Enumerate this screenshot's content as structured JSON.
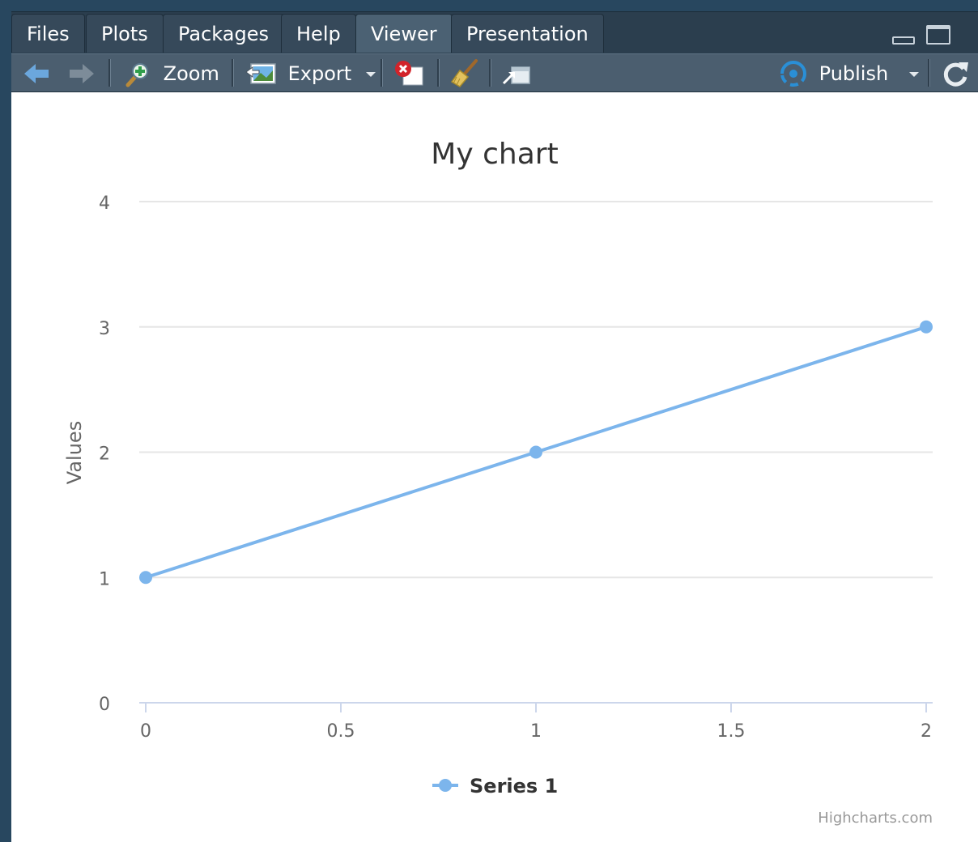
{
  "tabs": [
    {
      "label": "Files",
      "active": false
    },
    {
      "label": "Plots",
      "active": false
    },
    {
      "label": "Packages",
      "active": false
    },
    {
      "label": "Help",
      "active": false
    },
    {
      "label": "Viewer",
      "active": true
    },
    {
      "label": "Presentation",
      "active": false
    }
  ],
  "toolbar": {
    "zoom_label": "Zoom",
    "export_label": "Export",
    "publish_label": "Publish"
  },
  "colors": {
    "series": "#7cb5ec",
    "grid": "#e6e6e6",
    "axis": "#ccd6eb",
    "text": "#333333",
    "tick_text": "#666666"
  },
  "credits": "Highcharts.com",
  "chart_data": {
    "type": "line",
    "title": "My chart",
    "xlabel": "",
    "ylabel": "Values",
    "x_ticks": [
      "0",
      "0.5",
      "1",
      "1.5",
      "2"
    ],
    "y_ticks": [
      "0",
      "1",
      "2",
      "3",
      "4"
    ],
    "xlim": [
      0,
      2
    ],
    "ylim": [
      0,
      4
    ],
    "grid": true,
    "legend_position": "bottom-center",
    "series": [
      {
        "name": "Series 1",
        "x": [
          0,
          1,
          2
        ],
        "values": [
          1,
          2,
          3
        ]
      }
    ]
  }
}
